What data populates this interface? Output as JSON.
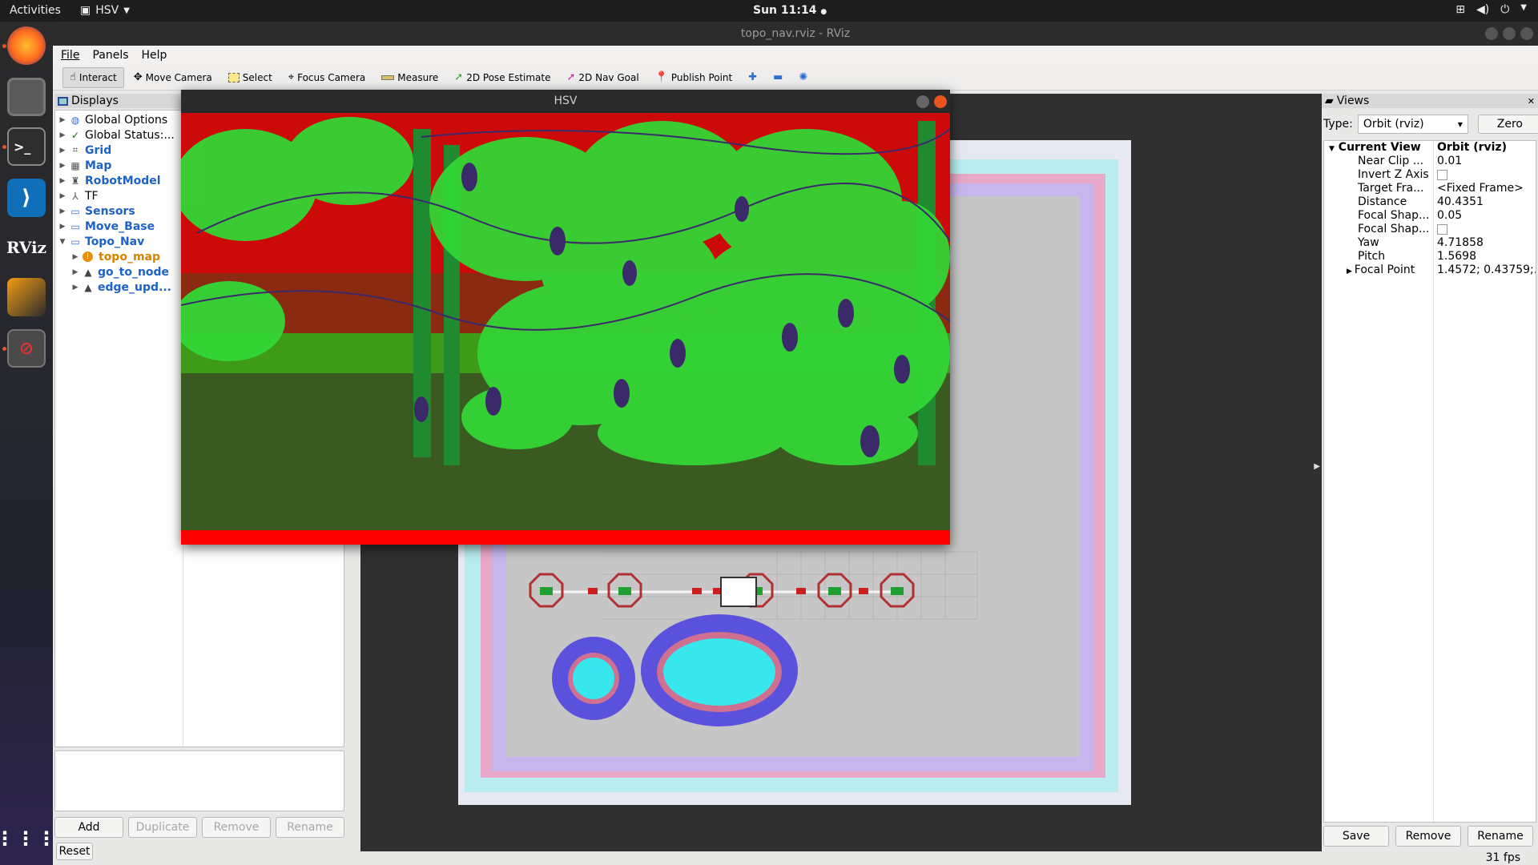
{
  "topbar": {
    "activities": "Activities",
    "app_name": "HSV",
    "clock": "Sun 11:14"
  },
  "window": {
    "title": "topo_nav.rviz - RViz"
  },
  "menu": [
    "File",
    "Panels",
    "Help"
  ],
  "toolbar": [
    {
      "label": "Interact",
      "icon": "hand-icon"
    },
    {
      "label": "Move Camera",
      "icon": "move-icon"
    },
    {
      "label": "Select",
      "icon": "select-icon"
    },
    {
      "label": "Focus Camera",
      "icon": "focus-icon"
    },
    {
      "label": "Measure",
      "icon": "ruler-icon"
    },
    {
      "label": "2D Pose Estimate",
      "icon": "pose-arrow-icon"
    },
    {
      "label": "2D Nav Goal",
      "icon": "goal-arrow-icon"
    },
    {
      "label": "Publish Point",
      "icon": "pin-icon"
    }
  ],
  "displays": {
    "title": "Displays",
    "items": [
      {
        "label": "Global Options",
        "style": "plain",
        "indent": 0
      },
      {
        "label": "Global Status:...",
        "style": "plain",
        "indent": 0
      },
      {
        "label": "Grid",
        "style": "blue",
        "indent": 0
      },
      {
        "label": "Map",
        "style": "blue",
        "indent": 0
      },
      {
        "label": "RobotModel",
        "style": "blue",
        "indent": 0
      },
      {
        "label": "TF",
        "style": "plain",
        "indent": 0
      },
      {
        "label": "Sensors",
        "style": "blue",
        "indent": 0
      },
      {
        "label": "Move_Base",
        "style": "blue",
        "indent": 0
      },
      {
        "label": "Topo_Nav",
        "style": "blue",
        "indent": 0
      },
      {
        "label": "topo_map",
        "style": "orange",
        "indent": 1
      },
      {
        "label": "go_to_node",
        "style": "blue",
        "indent": 1
      },
      {
        "label": "edge_upd...",
        "style": "blue",
        "indent": 1
      }
    ],
    "buttons": {
      "add": "Add",
      "duplicate": "Duplicate",
      "remove": "Remove",
      "rename": "Rename",
      "reset": "Reset"
    }
  },
  "hsv_window": {
    "title": "HSV"
  },
  "views": {
    "title": "Views",
    "type_label": "Type:",
    "type_value": "Orbit (rviz)",
    "zero": "Zero",
    "current_view": {
      "label": "Current View",
      "value": "Orbit (rviz)"
    },
    "props": [
      {
        "k": "Near Clip ...",
        "v": "0.01"
      },
      {
        "k": "Invert Z Axis",
        "v": ""
      },
      {
        "k": "Target Fra...",
        "v": "<Fixed Frame>"
      },
      {
        "k": "Distance",
        "v": "40.4351"
      },
      {
        "k": "Focal Shap...",
        "v": "0.05"
      },
      {
        "k": "Focal Shap...",
        "v": ""
      },
      {
        "k": "Yaw",
        "v": "4.71858"
      },
      {
        "k": "Pitch",
        "v": "1.5698"
      },
      {
        "k": "Focal Point",
        "v": "1.4572; 0.43759;..."
      }
    ],
    "buttons": {
      "save": "Save",
      "remove": "Remove",
      "rename": "Rename"
    },
    "fps": "31 fps"
  },
  "colors": {
    "accent": "#e95420",
    "hsv_sky": "#cc0a0a",
    "leaf": "#33d636",
    "map_cyan": "#b9ecee"
  }
}
